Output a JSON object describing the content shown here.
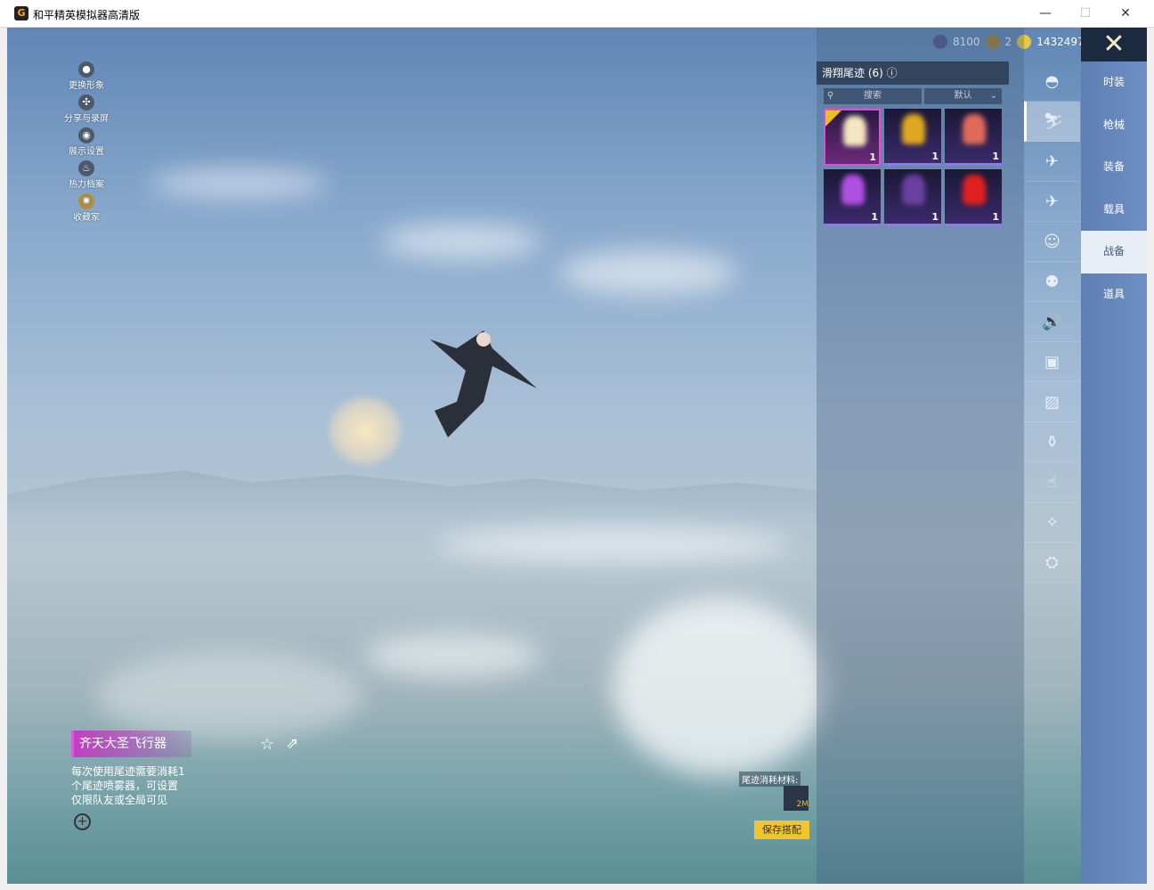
{
  "window": {
    "title": "和平精英模拟器高清版",
    "minimize": "—",
    "maximize": "☐",
    "close": "✕"
  },
  "currency": [
    {
      "name": "silver-coin",
      "value": "8100"
    },
    {
      "name": "token",
      "value": "2"
    },
    {
      "name": "gold-coin",
      "value": "1432497"
    }
  ],
  "left_menu": [
    {
      "label": "更换形象",
      "icon": "person-icon"
    },
    {
      "label": "分享与录屏",
      "icon": "share-icon"
    },
    {
      "label": "展示设置",
      "icon": "eye-icon"
    },
    {
      "label": "热力档案",
      "icon": "fire-icon"
    },
    {
      "label": "收藏家",
      "icon": "collector-icon"
    }
  ],
  "panel": {
    "title": "滑翔尾迹 (6)",
    "search_placeholder": "搜索",
    "sort": "默认",
    "items": [
      {
        "count": "1",
        "color": "#f4e6c0",
        "selected": true
      },
      {
        "count": "1",
        "color": "#e0a820"
      },
      {
        "count": "1",
        "color": "#e06a5a"
      },
      {
        "count": "1",
        "color": "#b050e0"
      },
      {
        "count": "1",
        "color": "#6a40a0"
      },
      {
        "count": "1",
        "color": "#e02020"
      }
    ]
  },
  "icon_tabs": [
    "hat-icon",
    "parachute-icon",
    "drone-icon",
    "plane-icon",
    "emote-icon",
    "bot-icon",
    "speaker-icon",
    "ticket-icon",
    "photo-icon",
    "spray-icon",
    "tap-icon",
    "sparkle-icon",
    "landing-icon"
  ],
  "categories": [
    {
      "label": "时装"
    },
    {
      "label": "枪械"
    },
    {
      "label": "装备"
    },
    {
      "label": "载具"
    },
    {
      "label": "战备",
      "selected": true
    },
    {
      "label": "道具"
    }
  ],
  "detail": {
    "name": "齐天大圣飞行器",
    "lines": [
      "每次使用尾迹需要消耗1",
      "个尾迹喷雾器，可设置",
      "仅限队友或全局可见"
    ]
  },
  "material_label": "尾迹消耗材料:",
  "material_count": "2M",
  "save_button": "保存搭配"
}
